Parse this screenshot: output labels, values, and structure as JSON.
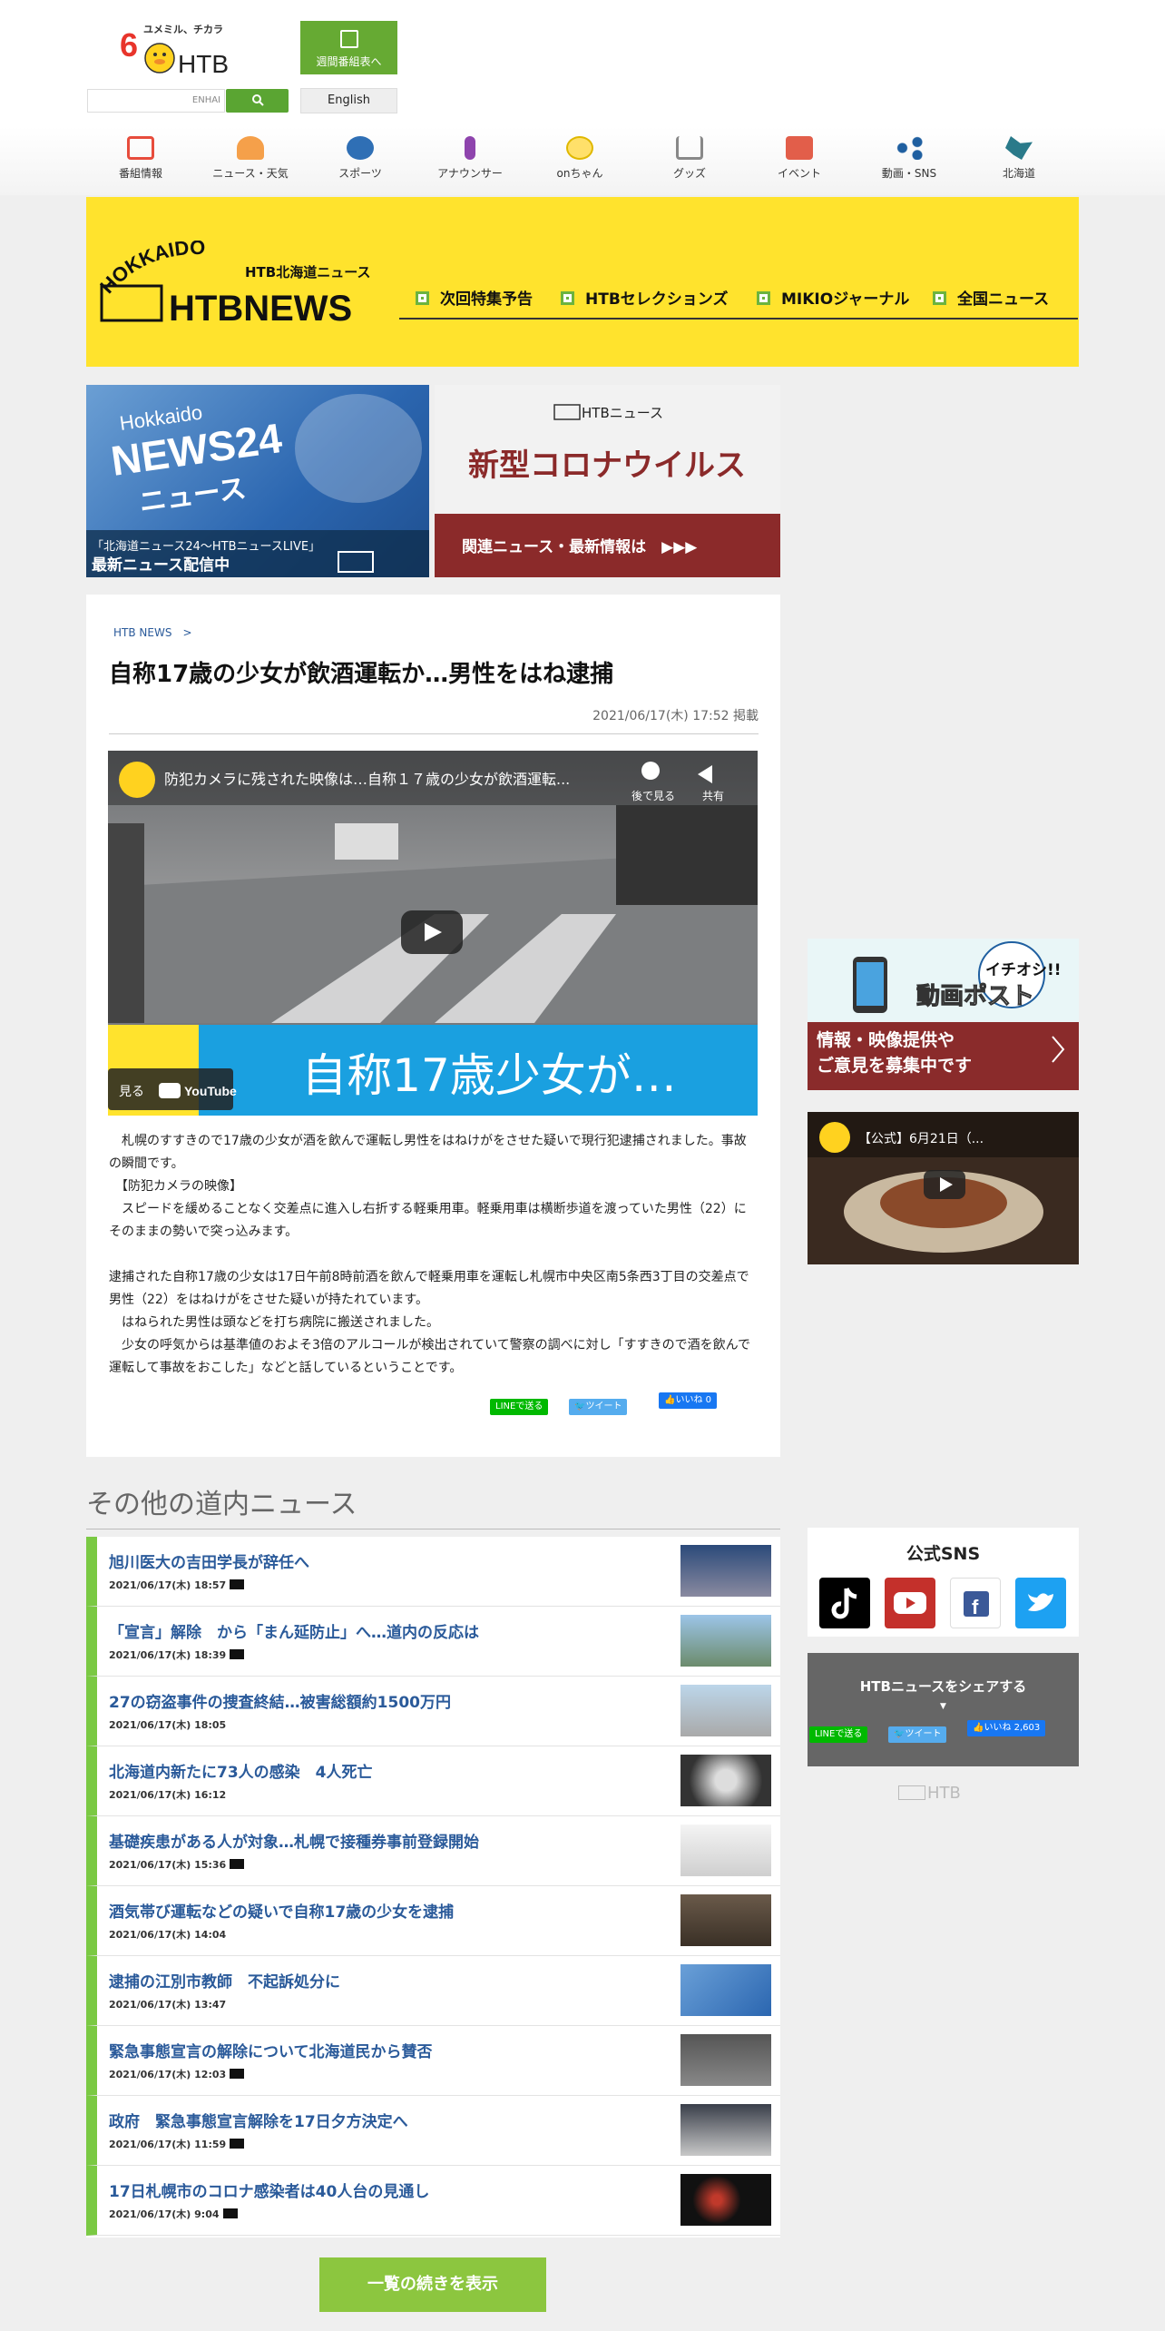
{
  "header": {
    "logo_tagline": "ユメミル、チカラ",
    "logo_channel": "6",
    "logo_text": "HTB",
    "weekly_schedule_label": "週間番組表へ",
    "search_placeholder": "ENHAI",
    "english_label": "English"
  },
  "nav": {
    "items": [
      {
        "label": "番組情報",
        "color": "#e74c3c"
      },
      {
        "label": "ニュース・天気",
        "color": "#f08c2a"
      },
      {
        "label": "スポーツ",
        "color": "#2f6fb5"
      },
      {
        "label": "アナウンサー",
        "color": "#8e44ad"
      },
      {
        "label": "onちゃん",
        "color": "#f5c518"
      },
      {
        "label": "グッズ",
        "color": "#888888"
      },
      {
        "label": "イベント",
        "color": "#e25e4a"
      },
      {
        "label": "動画・SNS",
        "color": "#1f5fa0"
      },
      {
        "label": "北海道",
        "color": "#2a7a8a"
      }
    ]
  },
  "banner": {
    "logo_hokkaido": "HOKKAIDO",
    "logo_sub": "HTB北海道ニュース",
    "logo_news": "HTBNEWS",
    "tabs": [
      "次回特集予告",
      "HTBセレクションズ",
      "MIKIOジャーナル",
      "全国ニュース"
    ]
  },
  "promo": {
    "news24_caption": "「北海道ニュース24～HTBニュースLIVE」",
    "news24_caption2": "最新ニュース配信中",
    "news24_title": "NEWS24",
    "news24_sub": "ニュース",
    "news24_brand": "Hokkaido",
    "corona_brand": "HTBニュース",
    "corona_title": "新型コロナウイルス",
    "corona_link": "関連ニュース・最新情報は　▶▶▶"
  },
  "article": {
    "breadcrumb": "HTB NEWS",
    "title": "自称17歳の少女が飲酒運転か…男性をはね逮捕",
    "date": "2021/06/17(木) 17:52 掲載",
    "video_title": "防犯カメラに残された映像は…自称１７歳の少女が飲酒運転...",
    "watch_later": "後で見る",
    "share": "共有",
    "video_caption": "自称17歳少女が…",
    "watch_on": "見る",
    "youtube": "YouTube",
    "body": "　札幌のすすきので17歳の少女が酒を飲んで運転し男性をはねけがをさせた疑いで現行犯逮捕されました。事故の瞬間です。\n　【防犯カメラの映像】\n　スピードを緩めることなく交差点に進入し右折する軽乗用車。軽乗用車は横断歩道を渡っていた男性（22）にそのままの勢いで突っ込みます。\n\n逮捕された自称17歳の少女は17日午前8時前酒を飲んで軽乗用車を運転し札幌市中央区南5条西3丁目の交差点で男性（22）をはねけがをさせた疑いが持たれています。\n　はねられた男性は頭などを打ち病院に搬送されました。\n　少女の呼気からは基準値のおよそ3倍のアルコールが検出されていて警察の調べに対し「すすきので酒を飲んで運転して事故をおこした」などと話しているということです。",
    "line_label": "LINEで送る",
    "tweet_label": "ツイート",
    "like_label": "いいね 0"
  },
  "others": {
    "heading": "その他の道内ニュース",
    "items": [
      {
        "title": "旭川医大の吉田学長が辞任へ",
        "date": "2021/06/17(木) 18:57",
        "video": true
      },
      {
        "title": "「宣言」解除　から「まん延防止」へ…道内の反応は",
        "date": "2021/06/17(木) 18:39",
        "video": true
      },
      {
        "title": "27の窃盗事件の捜査終結…被害総額約1500万円",
        "date": "2021/06/17(木) 18:05",
        "video": false
      },
      {
        "title": "北海道内新たに73人の感染　4人死亡",
        "date": "2021/06/17(木) 16:12",
        "video": false
      },
      {
        "title": "基礎疾患がある人が対象…札幌で接種券事前登録開始",
        "date": "2021/06/17(木) 15:36",
        "video": true
      },
      {
        "title": "酒気帯び運転などの疑いで自称17歳の少女を逮捕",
        "date": "2021/06/17(木) 14:04",
        "video": false
      },
      {
        "title": "逮捕の江別市教師　不起訴処分に",
        "date": "2021/06/17(木) 13:47",
        "video": false
      },
      {
        "title": "緊急事態宣言の解除について北海道民から賛否",
        "date": "2021/06/17(木) 12:03",
        "video": true
      },
      {
        "title": "政府　緊急事態宣言解除を17日夕方決定へ",
        "date": "2021/06/17(木) 11:59",
        "video": true
      },
      {
        "title": "17日札幌市のコロナ感染者は40人台の見通し",
        "date": "2021/06/17(木) 9:04",
        "video": true
      }
    ],
    "more_label": "一覧の続きを表示"
  },
  "sidebar": {
    "douga_title": "イチオシ!!",
    "douga_title2": "動画ポスト",
    "douga_text": "情報・映像提供や",
    "douga_text2": "ご意見を募集中です",
    "video_title": "【公式】6月21日（...",
    "sns_title": "公式SNS",
    "share_title": "HTBニュースをシェアする",
    "share_line": "LINEで送る",
    "share_tweet": "ツイート",
    "share_like": "いいね 2,603",
    "footer_logo": "HTB"
  }
}
